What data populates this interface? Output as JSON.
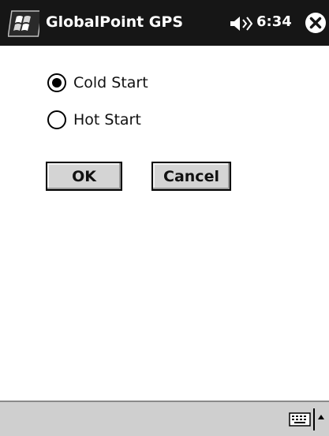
{
  "titlebar": {
    "app_title": "GlobalPoint GPS",
    "clock": "6:34",
    "icons": {
      "start": "windows-flag-icon",
      "volume": "speaker-icon",
      "close": "close-icon"
    }
  },
  "options": [
    {
      "label": "Cold Start",
      "checked": true
    },
    {
      "label": "Hot Start",
      "checked": false
    }
  ],
  "buttons": {
    "ok_label": "OK",
    "cancel_label": "Cancel"
  },
  "menubar": {
    "icons": {
      "keyboard": "keyboard-icon",
      "sip_toggle": "up-arrow-icon"
    }
  },
  "colors": {
    "titlebar_bg": "#161616",
    "button_face": "#d4d4d4",
    "menubar_bg": "#cfcfcf"
  }
}
